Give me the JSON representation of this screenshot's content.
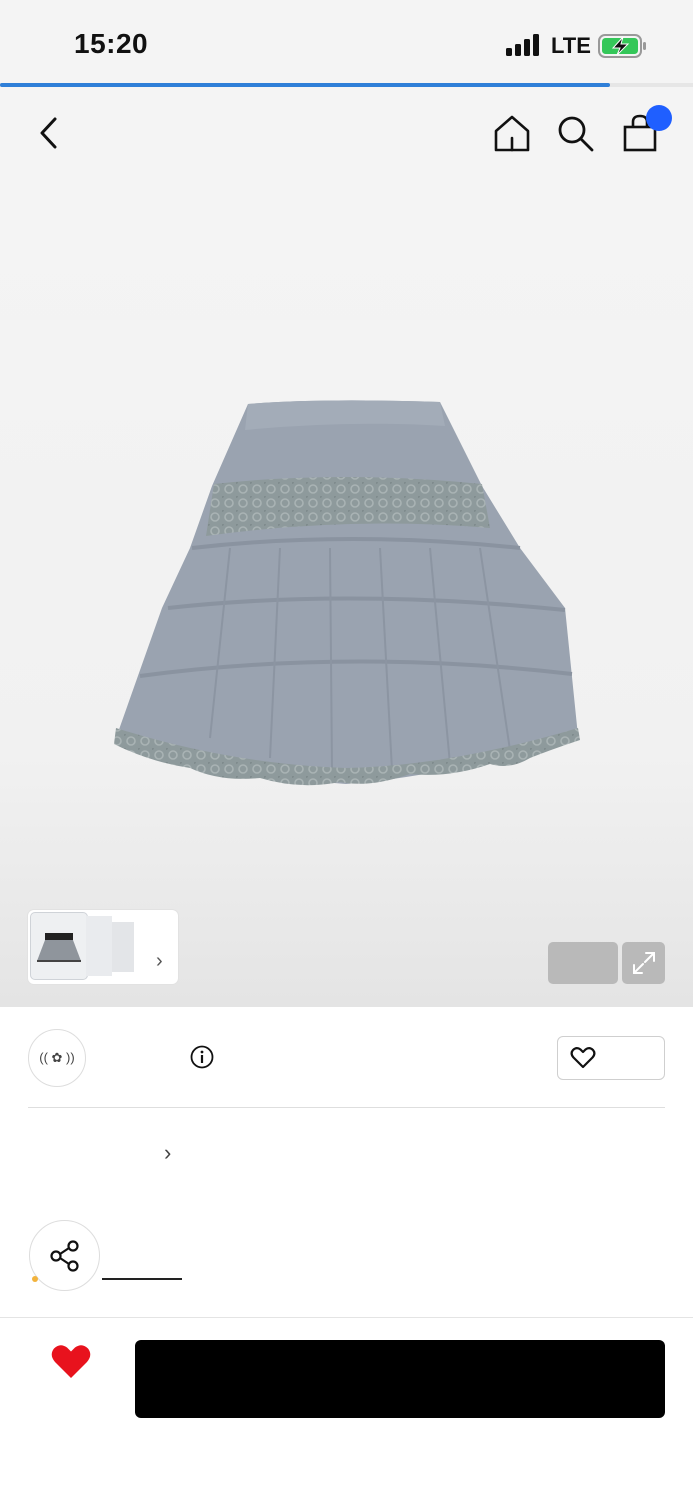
{
  "status_bar": {
    "time": "15:20",
    "network": "LTE",
    "page_load_progress": 0.88
  },
  "nav": {
    "icons": [
      "back-icon",
      "home-icon",
      "search-icon",
      "shopping-bag-icon"
    ]
  },
  "gallery": {
    "image": "grey-tiered-lace-skirt",
    "thumbnail_count": 3
  },
  "brand": {
    "logo_text": "(( ✿ ))"
  },
  "cta": {
    "label": ""
  },
  "colors": {
    "accent": "#1f5fff",
    "progress": "#2f7fd8",
    "favorite": "#e8121d",
    "cta_background": "#000000"
  }
}
